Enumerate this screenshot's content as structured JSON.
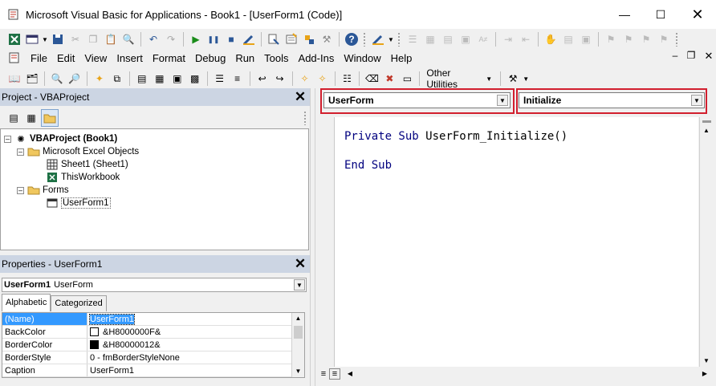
{
  "window": {
    "title": "Microsoft Visual Basic for Applications - Book1 - [UserForm1 (Code)]"
  },
  "menu": [
    "File",
    "Edit",
    "View",
    "Insert",
    "Format",
    "Debug",
    "Run",
    "Tools",
    "Add-Ins",
    "Window",
    "Help"
  ],
  "toolbar3": {
    "other_utilities": "Other Utilities"
  },
  "project": {
    "title": "Project - VBAProject",
    "tree": {
      "root": "VBAProject (Book1)",
      "excel_objects": "Microsoft Excel Objects",
      "sheet1": "Sheet1 (Sheet1)",
      "thisworkbook": "ThisWorkbook",
      "forms": "Forms",
      "userform1": "UserForm1"
    }
  },
  "properties": {
    "title": "Properties - UserForm1",
    "object_name": "UserForm1",
    "object_type": "UserForm",
    "tabs": [
      "Alphabetic",
      "Categorized"
    ],
    "rows": [
      {
        "name": "(Name)",
        "value": "UserForm1"
      },
      {
        "name": "BackColor",
        "value": "&H8000000F&",
        "swatch": "#ffffff"
      },
      {
        "name": "BorderColor",
        "value": "&H80000012&",
        "swatch": "#000000"
      },
      {
        "name": "BorderStyle",
        "value": "0 - fmBorderStyleNone"
      },
      {
        "name": "Caption",
        "value": "UserForm1"
      }
    ]
  },
  "code": {
    "object_combo": "UserForm",
    "procedure_combo": "Initialize",
    "line1_kw": "Private Sub ",
    "line1_name": "UserForm_Initialize()",
    "line2": "End Sub"
  },
  "colors": {
    "highlight_box": "#d21f2e",
    "keyword": "#00007f",
    "panel_header": "#ccd5e3"
  }
}
